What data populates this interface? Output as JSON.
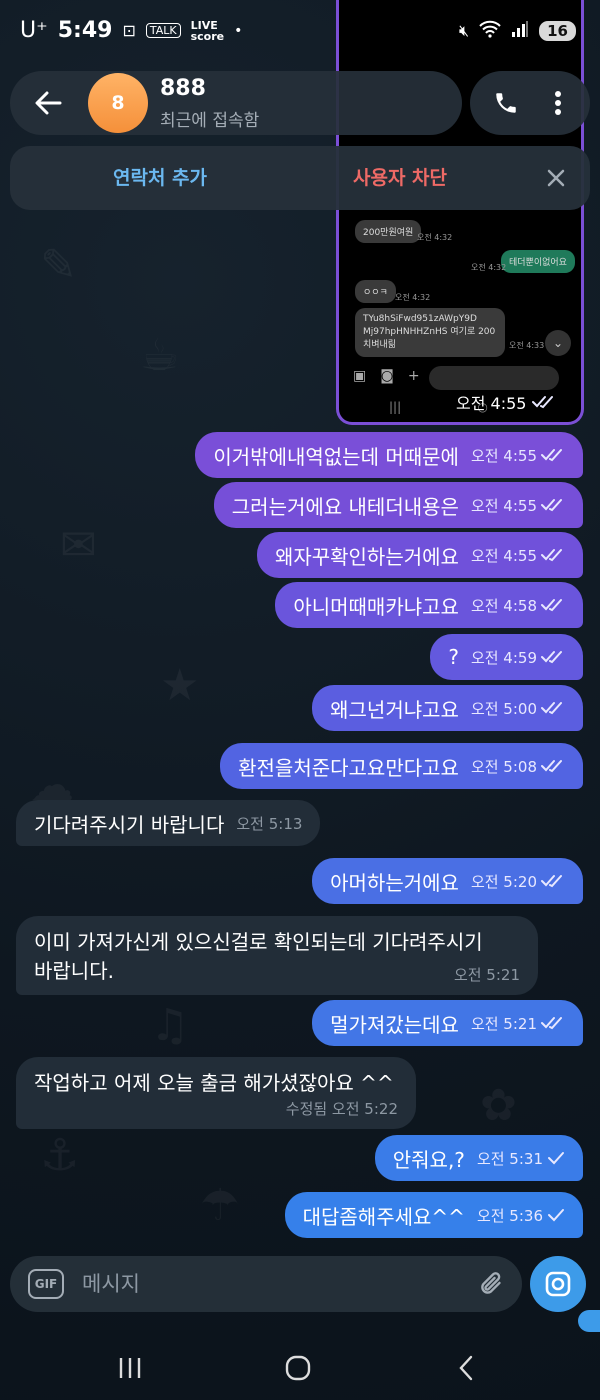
{
  "status_bar": {
    "carrier": "U⁺",
    "time": "5:49",
    "battery": "16",
    "talk_label": "TALK",
    "live_label": "LIVE",
    "score_label": "score",
    "dot": "•"
  },
  "header": {
    "avatar_letter": "8",
    "name": "888",
    "status": "최근에 접속함"
  },
  "action_bar": {
    "add_contact": "연락처 추가",
    "block_user": "사용자 차단"
  },
  "image_message": {
    "chips": [
      "200만원여원",
      "테더뿐이없어요",
      "ㅇㅇㅋ",
      "TYu8hSiFwd951zAWpY9D Mj97hpHNHHZnHS 여기로 200치벼내릶"
    ],
    "times": [
      "오전 4:32",
      "오전 4:32",
      "오전 4:32",
      "오전 4:33"
    ],
    "time": "오전 4:55"
  },
  "messages": [
    {
      "text": "이거밖에내역없는데 머때문에",
      "time": "오전 4:55",
      "dir": "out",
      "read": true
    },
    {
      "text": "그러는거에요 내테더내용은",
      "time": "오전 4:55",
      "dir": "out",
      "read": true
    },
    {
      "text": "왜자꾸확인하는거에요",
      "time": "오전 4:55",
      "dir": "out",
      "read": true
    },
    {
      "text": "아니머때매카냐고요",
      "time": "오전 4:58",
      "dir": "out",
      "read": true
    },
    {
      "text": "?",
      "time": "오전 4:59",
      "dir": "out",
      "read": true
    },
    {
      "text": "왜그넌거냐고요",
      "time": "오전 5:00",
      "dir": "out",
      "read": true
    },
    {
      "text": "환전을처준다고요만다고요",
      "time": "오전 5:08",
      "dir": "out",
      "read": true
    },
    {
      "text": "기다려주시기 바랍니다",
      "time": "오전 5:13",
      "dir": "in"
    },
    {
      "text": "아머하는거에요",
      "time": "오전 5:20",
      "dir": "out",
      "read": true
    },
    {
      "text_line1": "이미 가져가신게 있으신걸로 확인되는데 기다려주시기",
      "text_line2": "바랍니다.",
      "time": "오전 5:21",
      "dir": "in"
    },
    {
      "text": "멀가져갔는데요",
      "time": "오전 5:21",
      "dir": "out",
      "read": true
    },
    {
      "text": "작업하고 어제 오늘 출금 해가셨잖아요 ^^",
      "time": "수정됨 오전 5:22",
      "dir": "in"
    },
    {
      "text": "안줘요,?",
      "time": "오전 5:31",
      "dir": "out",
      "read": false
    },
    {
      "text": "대답좀해주세요^^",
      "time": "오전 5:36",
      "dir": "out",
      "read": false
    }
  ],
  "composer": {
    "gif_label": "GIF",
    "placeholder": "메시지"
  },
  "colors": {
    "accent": "#3d9be9",
    "bubble_purple": "#7b4fd6",
    "bubble_blue": "#3d80e6",
    "block_red": "#ee6a66",
    "add_blue": "#6bb8f0"
  }
}
